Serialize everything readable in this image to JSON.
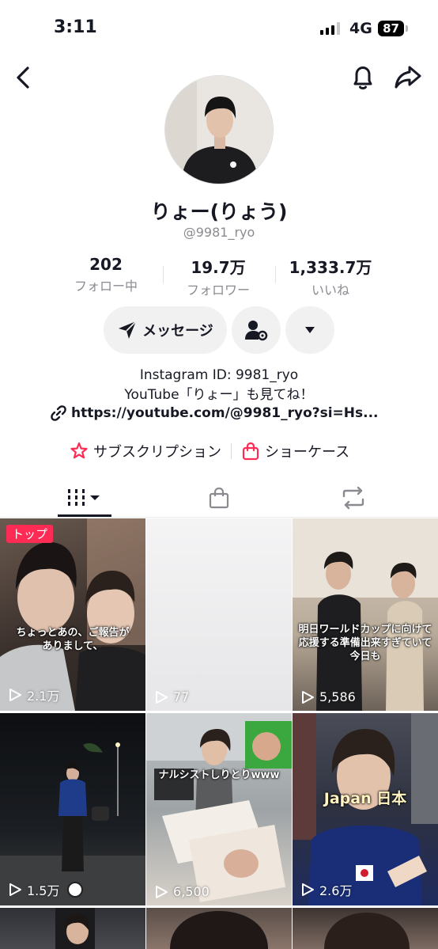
{
  "status_bar": {
    "time": "3:11",
    "network": "4G",
    "battery": "87"
  },
  "profile": {
    "display_name": "りょー(りょう)",
    "handle": "@9981_ryo",
    "stats": [
      {
        "value": "202",
        "label": "フォロー中"
      },
      {
        "value": "19.7万",
        "label": "フォロワー"
      },
      {
        "value": "1,333.7万",
        "label": "いいね"
      }
    ],
    "message_label": "メッセージ",
    "bio_lines": [
      "Instagram ID: 9981_ryo",
      "YouTube「りょー」も見てね！"
    ],
    "link": "https://youtube.com/@9981_ryo?si=Hs...",
    "subscription_label": "サブスクリプション",
    "showcase_label": "ショーケース"
  },
  "colors": {
    "accent": "#fe2c55",
    "text": "#161823",
    "muted": "#8a8b91",
    "button_bg": "#f1f1f2"
  },
  "videos": [
    {
      "views": "2.1万",
      "badge": "トップ",
      "caption": "ちょっとあの、ご報告が\nありまして、"
    },
    {
      "views": "77",
      "badge": "",
      "caption": ""
    },
    {
      "views": "5,586",
      "badge": "",
      "caption": "明日ワールドカップに向けて\n応援する準備出来すぎていて\n今日も"
    },
    {
      "views": "1.5万",
      "badge": "",
      "caption": ""
    },
    {
      "views": "6,500",
      "badge": "",
      "caption": "ナルシストしりとりwww"
    },
    {
      "views": "2.6万",
      "badge": "",
      "caption": "Japan  日本"
    }
  ]
}
